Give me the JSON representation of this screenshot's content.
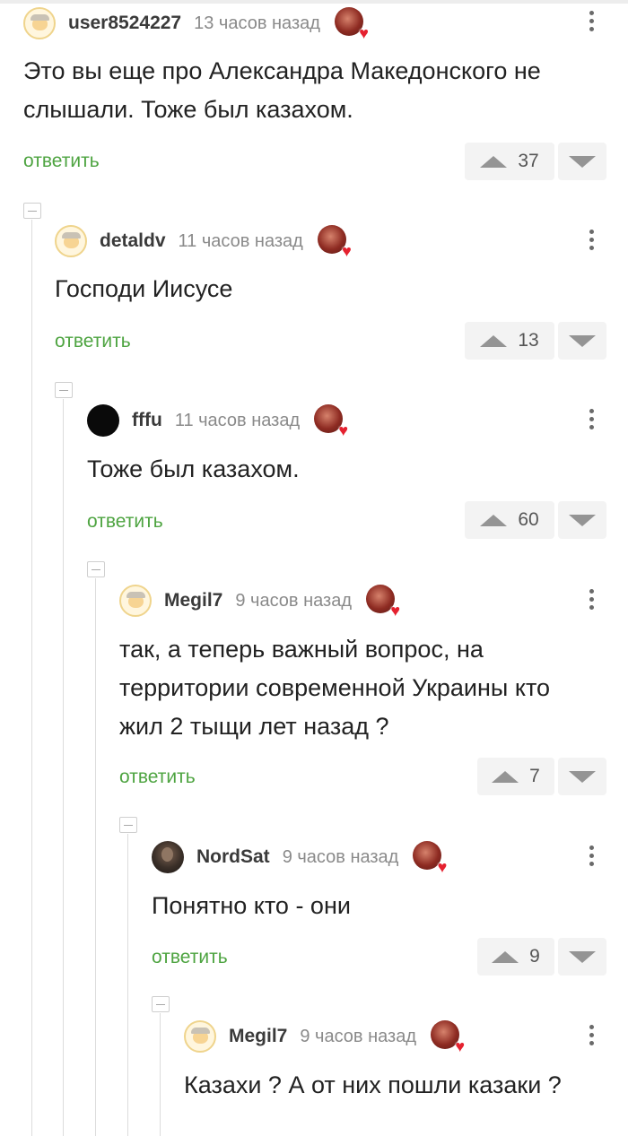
{
  "comments": [
    {
      "user": "user8524227",
      "time": "13 часов назад",
      "text": "Это вы еще про Александра Македонского не слышали. Тоже был казахом.",
      "reply": "ответить",
      "votes": "37",
      "avatar": "default-avatar"
    },
    {
      "user": "detaldv",
      "time": "11 часов назад",
      "text": "Господи Иисусе",
      "reply": "ответить",
      "votes": "13",
      "avatar": "default-avatar"
    },
    {
      "user": "fffu",
      "time": "11 часов назад",
      "text": "Тоже был казахом.",
      "reply": "ответить",
      "votes": "60",
      "avatar": "black-circle-avatar"
    },
    {
      "user": "Megil7",
      "time": "9 часов назад",
      "text": "так, а теперь важный вопрос, на территории современной Украины кто жил 2 тыщи лет назад ?",
      "reply": "ответить",
      "votes": "7",
      "avatar": "default-avatar"
    },
    {
      "user": "NordSat",
      "time": "9 часов назад",
      "text": "Понятно кто - они",
      "reply": "ответить",
      "votes": "9",
      "avatar": "photo-avatar"
    },
    {
      "user": "Megil7",
      "time": "9 часов назад",
      "text": "Казахи ? А от них пошли казаки ?",
      "reply": null,
      "votes": null,
      "avatar": "default-avatar"
    }
  ],
  "colors": {
    "reply_link": "#4ea441",
    "vote_bg": "#f3f3f3",
    "heart": "#e5212f"
  },
  "icons": {
    "badge": "award-badge-icon",
    "heart": "heart-icon",
    "menu": "kebab-menu-icon",
    "upvote": "upvote-arrow-icon",
    "downvote": "downvote-arrow-icon",
    "collapse": "collapse-thread-icon"
  }
}
